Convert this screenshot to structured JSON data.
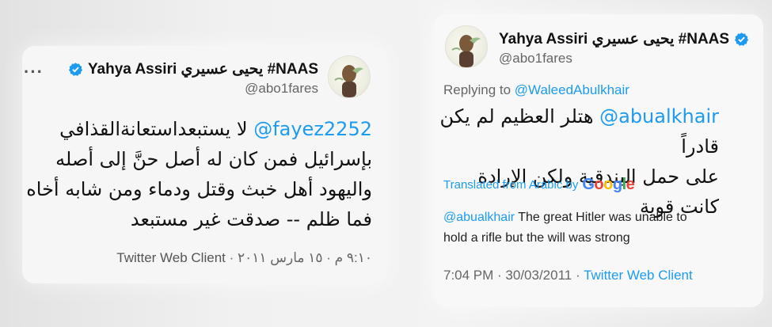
{
  "left_tweet": {
    "display_name": "Yahya Assiri يحيى عسيري #NAAS",
    "handle": "@abo1fares",
    "more_label": "···",
    "mention": "@fayez2252",
    "line1_rest": " لا يستبعداستعانةالقذافي",
    "line2": "بإسرائيل فمن كان له أصل حنَّ إلى أصله",
    "line3": "واليهود أهل خبث وقتل ودماء ومن شابه أخاه",
    "line4": "فما ظلم -- صدقت غير مستبعد",
    "timestamp": "٩:١٠ م · ١٥ مارس ٢٠١١",
    "separator": "·",
    "client": "Twitter Web Client"
  },
  "right_tweet": {
    "display_name": "Yahya Assiri يحيى عسيري #NAAS",
    "handle": "@abo1fares",
    "replying_prefix": "Replying to ",
    "replying_to": "@WaleedAbulkhair",
    "mention": "@abualkhair",
    "line1_rest": " هتلر العظيم لم يكن قادراً",
    "line2": "على حمل البندقية ولكن الإرادة كانت قوية",
    "translated_label": "Translated from Arabic by",
    "google_letters": [
      "G",
      "o",
      "o",
      "g",
      "l",
      "e"
    ],
    "translation_mention": "@abualkhair",
    "translation_line1": " The great Hitler was unable to",
    "translation_line2": "hold a rifle but the will was strong",
    "timestamp": "7:04 PM · 30/03/2011",
    "separator": "·",
    "client": "Twitter Web Client"
  },
  "colors": {
    "link_blue": "#1d9bf0",
    "verified_blue": "#1d9bf0"
  },
  "icons": [
    "verified-badge-icon",
    "more-options-icon",
    "avatar-image"
  ]
}
